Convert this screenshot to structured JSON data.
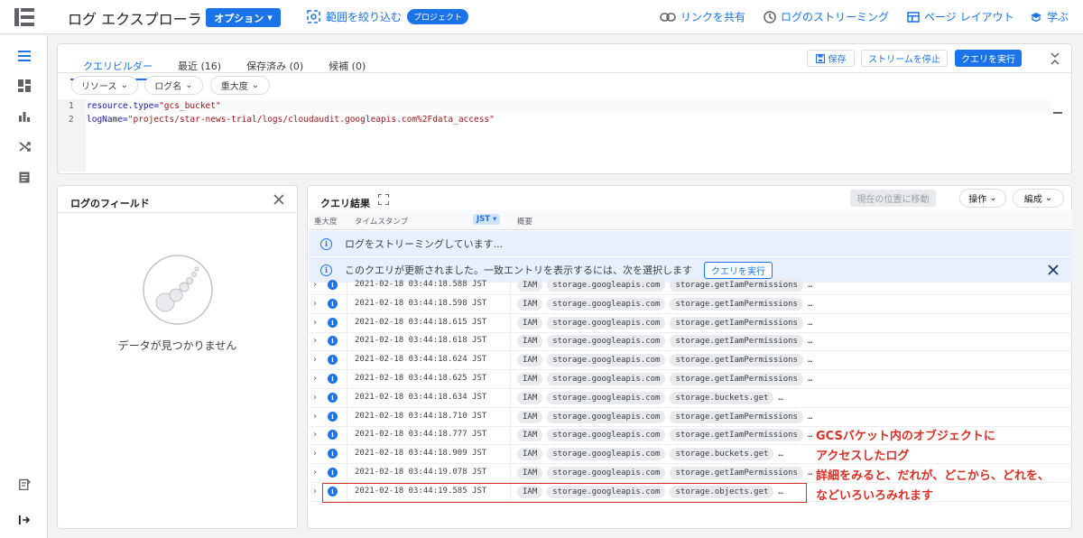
{
  "topbar": {
    "title": "ログ エクスプローラ",
    "options_label": "オプション",
    "scope_label": "範囲を絞り込む",
    "project_chip": "プロジェクト",
    "links": [
      "リンクを共有",
      "ログのストリーミング",
      "ページ レイアウト",
      "学ぶ"
    ]
  },
  "query": {
    "tabs": [
      "クエリビルダー",
      "最近 (16)",
      "保存済み (0)",
      "候補 (0)"
    ],
    "save_label": "保存",
    "stop_stream_label": "ストリームを停止",
    "run_label": "クエリを実行",
    "filters": [
      "リソース",
      "ログ名",
      "重大度"
    ],
    "lines": [
      {
        "num": "1",
        "key": "resource.type=",
        "val": "\"gcs_bucket\""
      },
      {
        "num": "2",
        "key": "logName=",
        "val": "\"projects/star-news-trial/logs/cloudaudit.googleapis.com%2Fdata_access\""
      }
    ]
  },
  "fields": {
    "title": "ログのフィールド",
    "empty_text": "データが見つかりません"
  },
  "results": {
    "title": "クエリ結果",
    "jump_label": "現在の位置に移動",
    "actions_label": "操作",
    "edit_label": "編成",
    "col_severity": "重大度",
    "col_timestamp": "タイムスタンプ",
    "tz_chip": "JST",
    "col_summary": "概要",
    "streaming_msg": "ログをストリーミングしています...",
    "updated_msg": "このクエリが更新されました。一致エントリを表示するには、次を選択します",
    "updated_btn": "クエリを実行",
    "rows": [
      {
        "ts": "2021-02-18 03:44:18.588 JST",
        "tags": [
          "IAM",
          "storage.googleapis.com",
          "storage.getIamPermissions"
        ],
        "more": "…"
      },
      {
        "ts": "2021-02-18 03:44:18.598 JST",
        "tags": [
          "IAM",
          "storage.googleapis.com",
          "storage.getIamPermissions"
        ],
        "more": "…"
      },
      {
        "ts": "2021-02-18 03:44:18.615 JST",
        "tags": [
          "IAM",
          "storage.googleapis.com",
          "storage.getIamPermissions"
        ],
        "more": "…"
      },
      {
        "ts": "2021-02-18 03:44:18.618 JST",
        "tags": [
          "IAM",
          "storage.googleapis.com",
          "storage.getIamPermissions"
        ],
        "more": "…"
      },
      {
        "ts": "2021-02-18 03:44:18.624 JST",
        "tags": [
          "IAM",
          "storage.googleapis.com",
          "storage.getIamPermissions"
        ],
        "more": "…"
      },
      {
        "ts": "2021-02-18 03:44:18.625 JST",
        "tags": [
          "IAM",
          "storage.googleapis.com",
          "storage.getIamPermissions"
        ],
        "more": "…"
      },
      {
        "ts": "2021-02-18 03:44:18.634 JST",
        "tags": [
          "IAM",
          "storage.googleapis.com",
          "storage.buckets.get"
        ],
        "more": "…"
      },
      {
        "ts": "2021-02-18 03:44:18.710 JST",
        "tags": [
          "IAM",
          "storage.googleapis.com",
          "storage.getIamPermissions"
        ],
        "more": "…"
      },
      {
        "ts": "2021-02-18 03:44:18.777 JST",
        "tags": [
          "IAM",
          "storage.googleapis.com",
          "storage.getIamPermissions"
        ],
        "more": "…"
      },
      {
        "ts": "2021-02-18 03:44:18.909 JST",
        "tags": [
          "IAM",
          "storage.googleapis.com",
          "storage.buckets.get"
        ],
        "more": "…"
      },
      {
        "ts": "2021-02-18 03:44:19.078 JST",
        "tags": [
          "IAM",
          "storage.googleapis.com",
          "storage.getIamPermissions"
        ],
        "more": "…"
      },
      {
        "ts": "2021-02-18 03:44:19.585 JST",
        "tags": [
          "IAM",
          "storage.googleapis.com",
          "storage.objects.get"
        ],
        "more": "…"
      }
    ]
  },
  "annotation": {
    "line1": "GCSバケット内のオブジェクトに",
    "line2": "アクセスしたログ",
    "line3": "詳細をみると、だれが、どこから、どれを、",
    "line4": "などいろいろみれます",
    "color": "#d93025"
  },
  "colors": {
    "accent": "#1a73e8",
    "highlight_border": "#d93025"
  }
}
